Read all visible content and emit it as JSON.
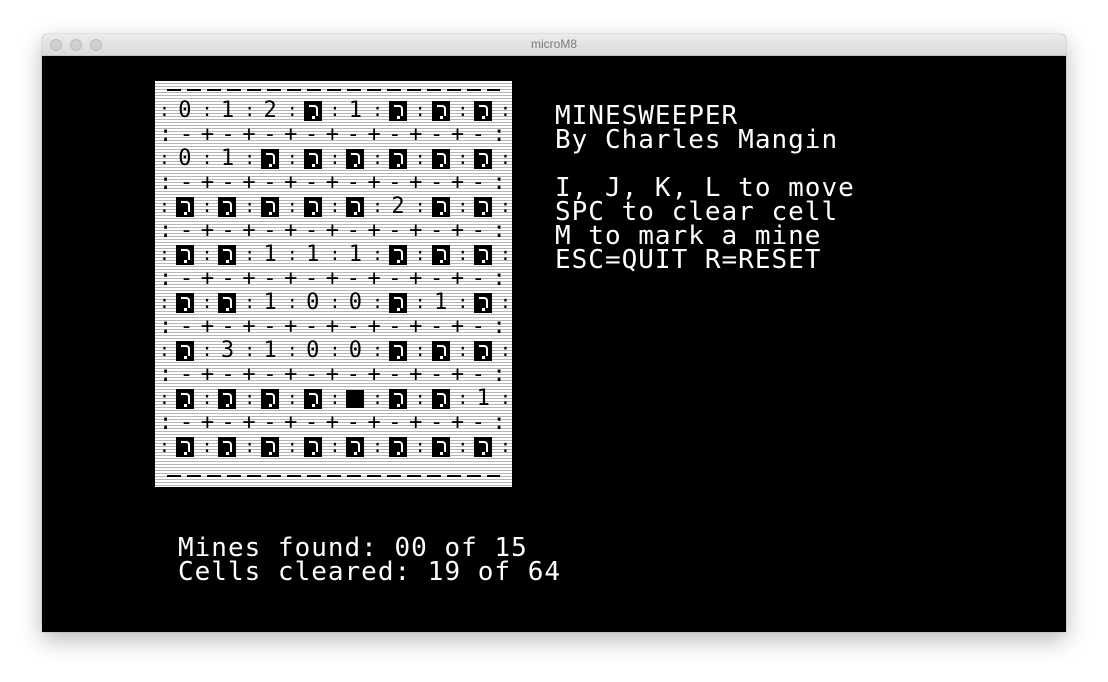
{
  "window": {
    "title": "microM8"
  },
  "board": {
    "rows": [
      [
        "0",
        "1",
        "2",
        "?",
        "1",
        "?",
        "?",
        "?"
      ],
      [
        "0",
        "1",
        "?",
        "?",
        "?",
        "?",
        "?",
        "?"
      ],
      [
        "?",
        "?",
        "?",
        "?",
        "?",
        "2",
        "?",
        "?"
      ],
      [
        "?",
        "?",
        "1",
        "1",
        "1",
        "?",
        "?",
        "?"
      ],
      [
        "?",
        "?",
        "1",
        "0",
        "0",
        "?",
        "1",
        "?"
      ],
      [
        "?",
        "3",
        "1",
        "0",
        "0",
        "?",
        "?",
        "?"
      ],
      [
        "?",
        "?",
        "?",
        "?",
        "#",
        "?",
        "?",
        "1"
      ],
      [
        "?",
        "?",
        "?",
        "?",
        "?",
        "?",
        "?",
        "?"
      ]
    ],
    "covered_symbol": "?",
    "cursor_symbol": "#"
  },
  "info": {
    "title": "MINESWEEPER",
    "author": "By Charles Mangin",
    "help": [
      "I, J, K, L to move",
      "SPC to clear cell",
      "M to mark a mine",
      "ESC=QUIT R=RESET"
    ]
  },
  "status": {
    "mines_found": "Mines found: 00 of 15",
    "cells_cleared": "Cells cleared: 19 of 64"
  }
}
